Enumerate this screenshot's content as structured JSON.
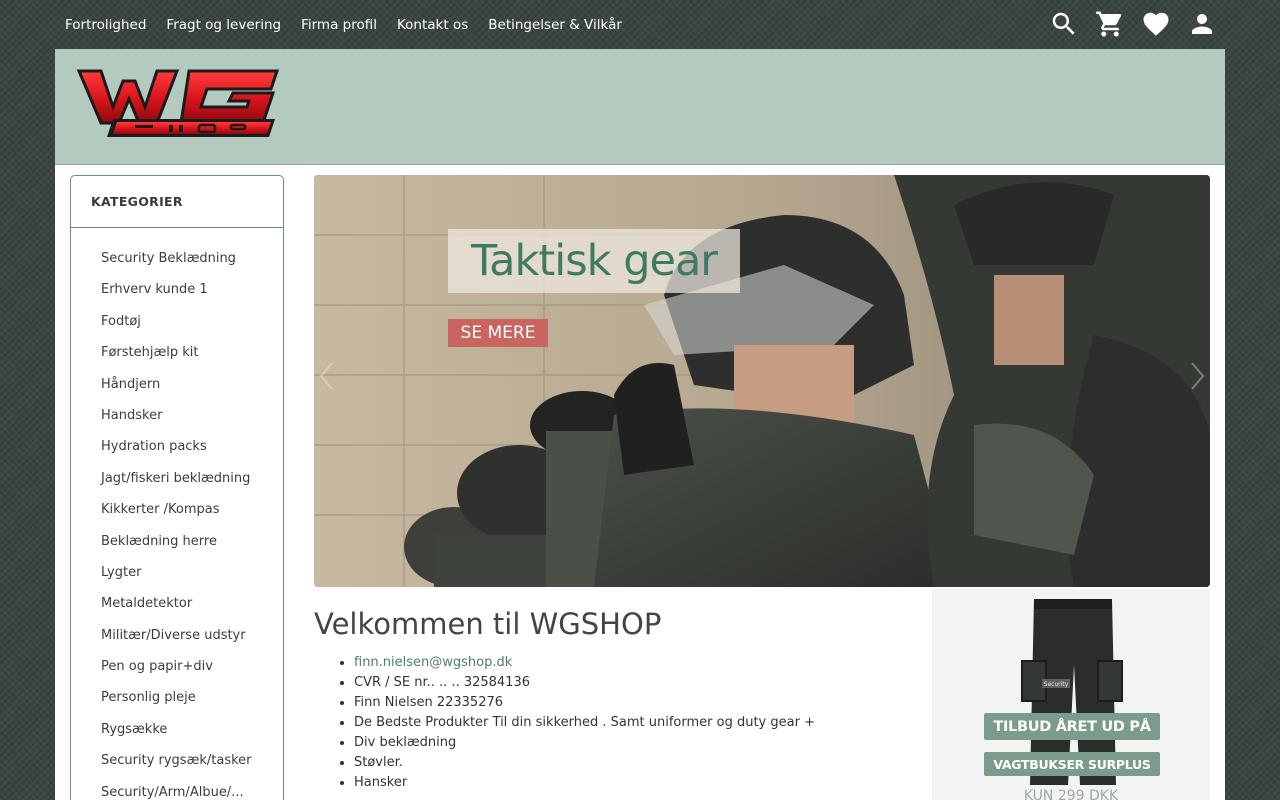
{
  "topnav": {
    "links": [
      "Fortrolighed",
      "Fragt og levering",
      "Firma profil",
      "Kontakt os",
      "Betingelser & Vilkår"
    ],
    "icons": [
      "search-icon",
      "cart-icon",
      "heart-icon",
      "user-icon"
    ]
  },
  "header": {
    "logo_text": "WGSHOP"
  },
  "sidebar": {
    "heading": "KATEGORIER",
    "items": [
      "Security Beklædning",
      "Erhverv kunde 1",
      "Fodtøj",
      "Førstehjælp kit",
      "Håndjern",
      "Handsker",
      "Hydration packs",
      "Jagt/fiskeri beklædning",
      "Kikkerter /Kompas",
      "Beklædning herre",
      "Lygter",
      "Metaldetektor",
      "Militær/Diverse udstyr",
      "Pen og papir+div",
      "Personlig pleje",
      "Rygsække",
      "Security rygsæk/tasker",
      "Security/Arm/Albue/..."
    ]
  },
  "slider": {
    "title": "Taktisk gear",
    "button": "SE MERE"
  },
  "welcome": {
    "title": "Velkommen til WGSHOP",
    "email": "finn.nielsen@wgshop.dk",
    "items": [
      "CVR / SE nr.. .. .. 32584136",
      "Finn Nielsen 22335276",
      "De Bedste Produkter Til din sikkerhed . Samt uniformer og duty gear +",
      "Div beklædning",
      "Støvler.",
      "Hansker"
    ]
  },
  "promo": {
    "banner1": "TILBUD ÅRET UD PÅ",
    "banner2": "VAGTBUKSER SURPLUS",
    "price": "KUN 299 DKK",
    "patch": "Security"
  },
  "colors": {
    "header_band": "#b4cabf",
    "accent_green": "#4e7d6e",
    "slide_button": "#c9645f",
    "logo_red": "#d8141b"
  }
}
